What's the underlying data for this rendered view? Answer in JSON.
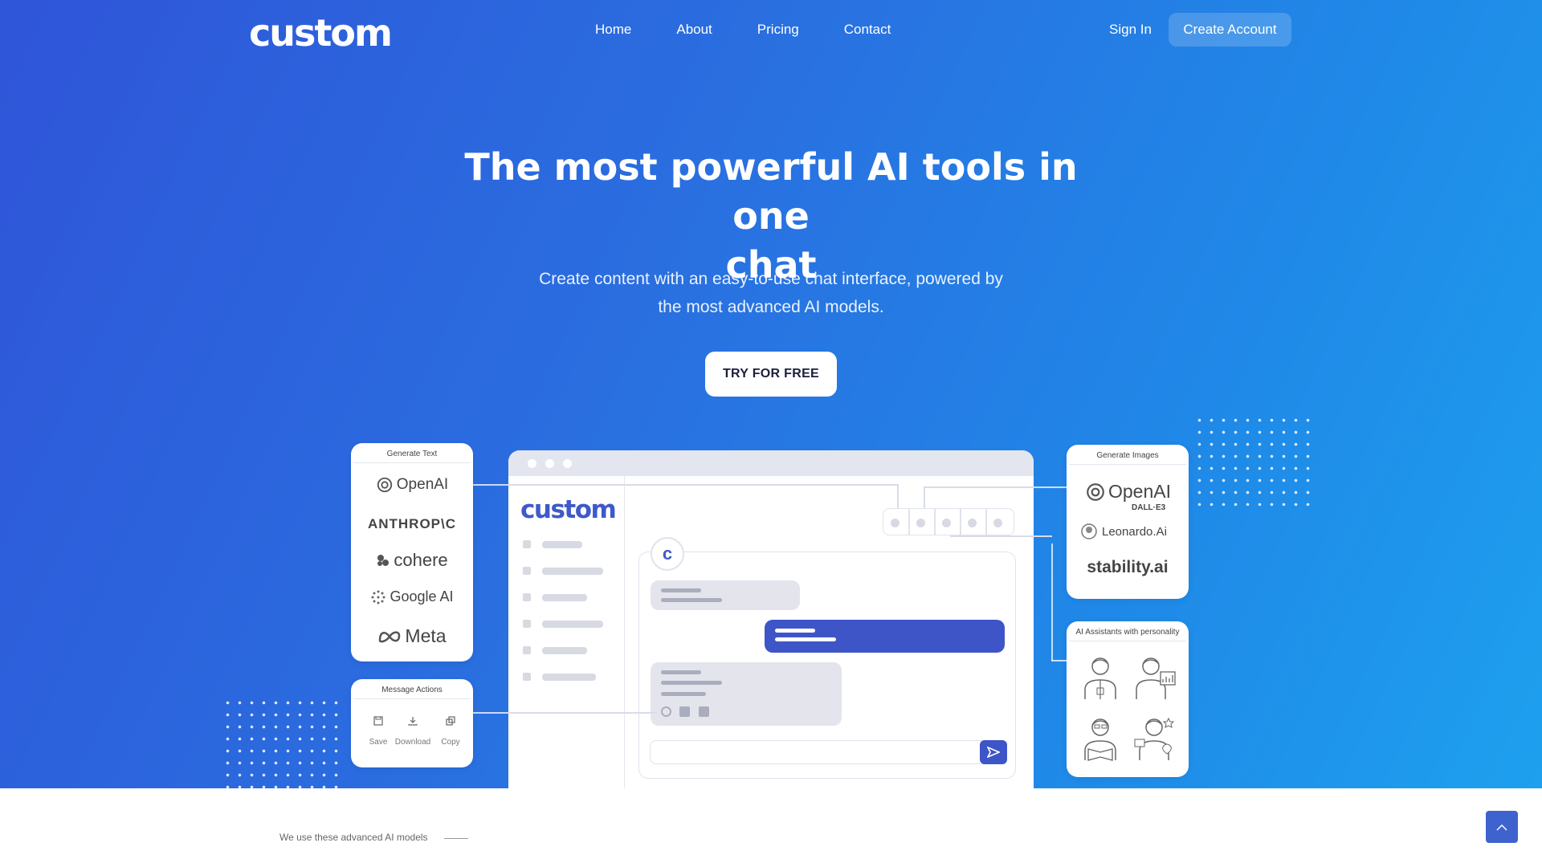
{
  "nav": {
    "logo": "custom",
    "links": [
      "Home",
      "About",
      "Pricing",
      "Contact"
    ],
    "sign_in": "Sign In",
    "create_account": "Create Account"
  },
  "hero": {
    "headline_line1": "The most powerful AI tools in one",
    "headline_line2": "chat",
    "subline_line1": "Create content with an easy-to-use chat interface, powered by",
    "subline_line2": "the most advanced AI models.",
    "cta": "TRY FOR FREE"
  },
  "cards": {
    "generate_text": {
      "title": "Generate Text",
      "brands": [
        "OpenAI",
        "ANTHROP\\C",
        "cohere",
        "Google AI",
        "Meta"
      ]
    },
    "message_actions": {
      "title": "Message Actions",
      "actions": [
        "Save",
        "Download",
        "Copy"
      ]
    },
    "generate_images": {
      "title": "Generate Images",
      "brands": [
        "OpenAI",
        "DALL·E3",
        "Leonardo.Ai",
        "stability.ai"
      ]
    },
    "assistants": {
      "title": "AI Assistants with personality"
    }
  },
  "mock": {
    "logo": "custom",
    "avatar_letter": "c"
  },
  "footer": {
    "models_label": "We use these advanced AI models"
  },
  "colors": {
    "accent": "#3e55c7",
    "hero_start": "#2f55d8",
    "hero_end": "#1ea0ee"
  }
}
